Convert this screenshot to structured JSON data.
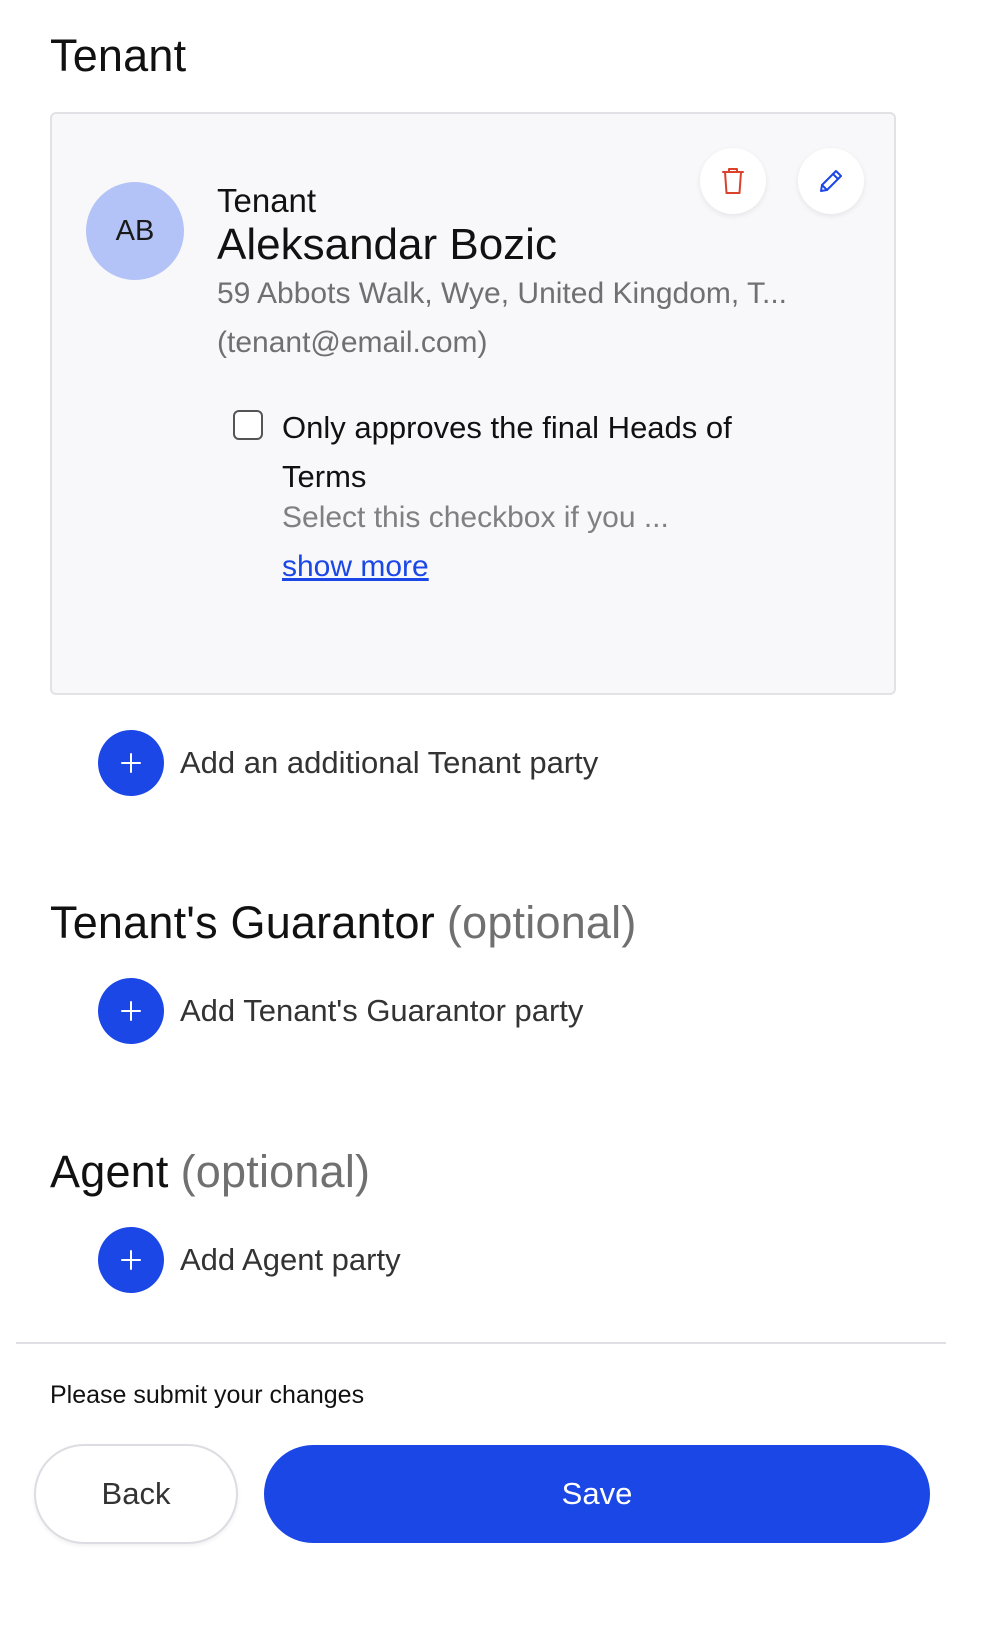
{
  "sections": {
    "tenant": {
      "title": "Tenant",
      "card": {
        "avatar_initials": "AB",
        "role": "Tenant",
        "name": "Aleksandar Bozic",
        "address": "59 Abbots Walk, Wye, United Kingdom, T...",
        "email": "(tenant@email.com)",
        "delete_icon": "trash-icon",
        "edit_icon": "pencil-icon",
        "checkbox": {
          "checked": false,
          "label": "Only approves the final Heads of Terms",
          "description": "Select this checkbox if you ...",
          "show_more": "show more"
        }
      },
      "add_label": "Add an additional Tenant party"
    },
    "guarantor": {
      "title": "Tenant's Guarantor",
      "optional": "(optional)",
      "add_label": "Add Tenant's Guarantor party"
    },
    "agent": {
      "title": "Agent",
      "optional": "(optional)",
      "add_label": "Add Agent party"
    }
  },
  "footer": {
    "note": "Please submit your changes",
    "back_label": "Back",
    "save_label": "Save"
  },
  "colors": {
    "accent": "#1b47e6",
    "avatar_bg": "#b3c3f7",
    "delete_icon": "#d9432c",
    "muted_text": "#707070"
  },
  "icons": {
    "add": "plus-icon"
  }
}
